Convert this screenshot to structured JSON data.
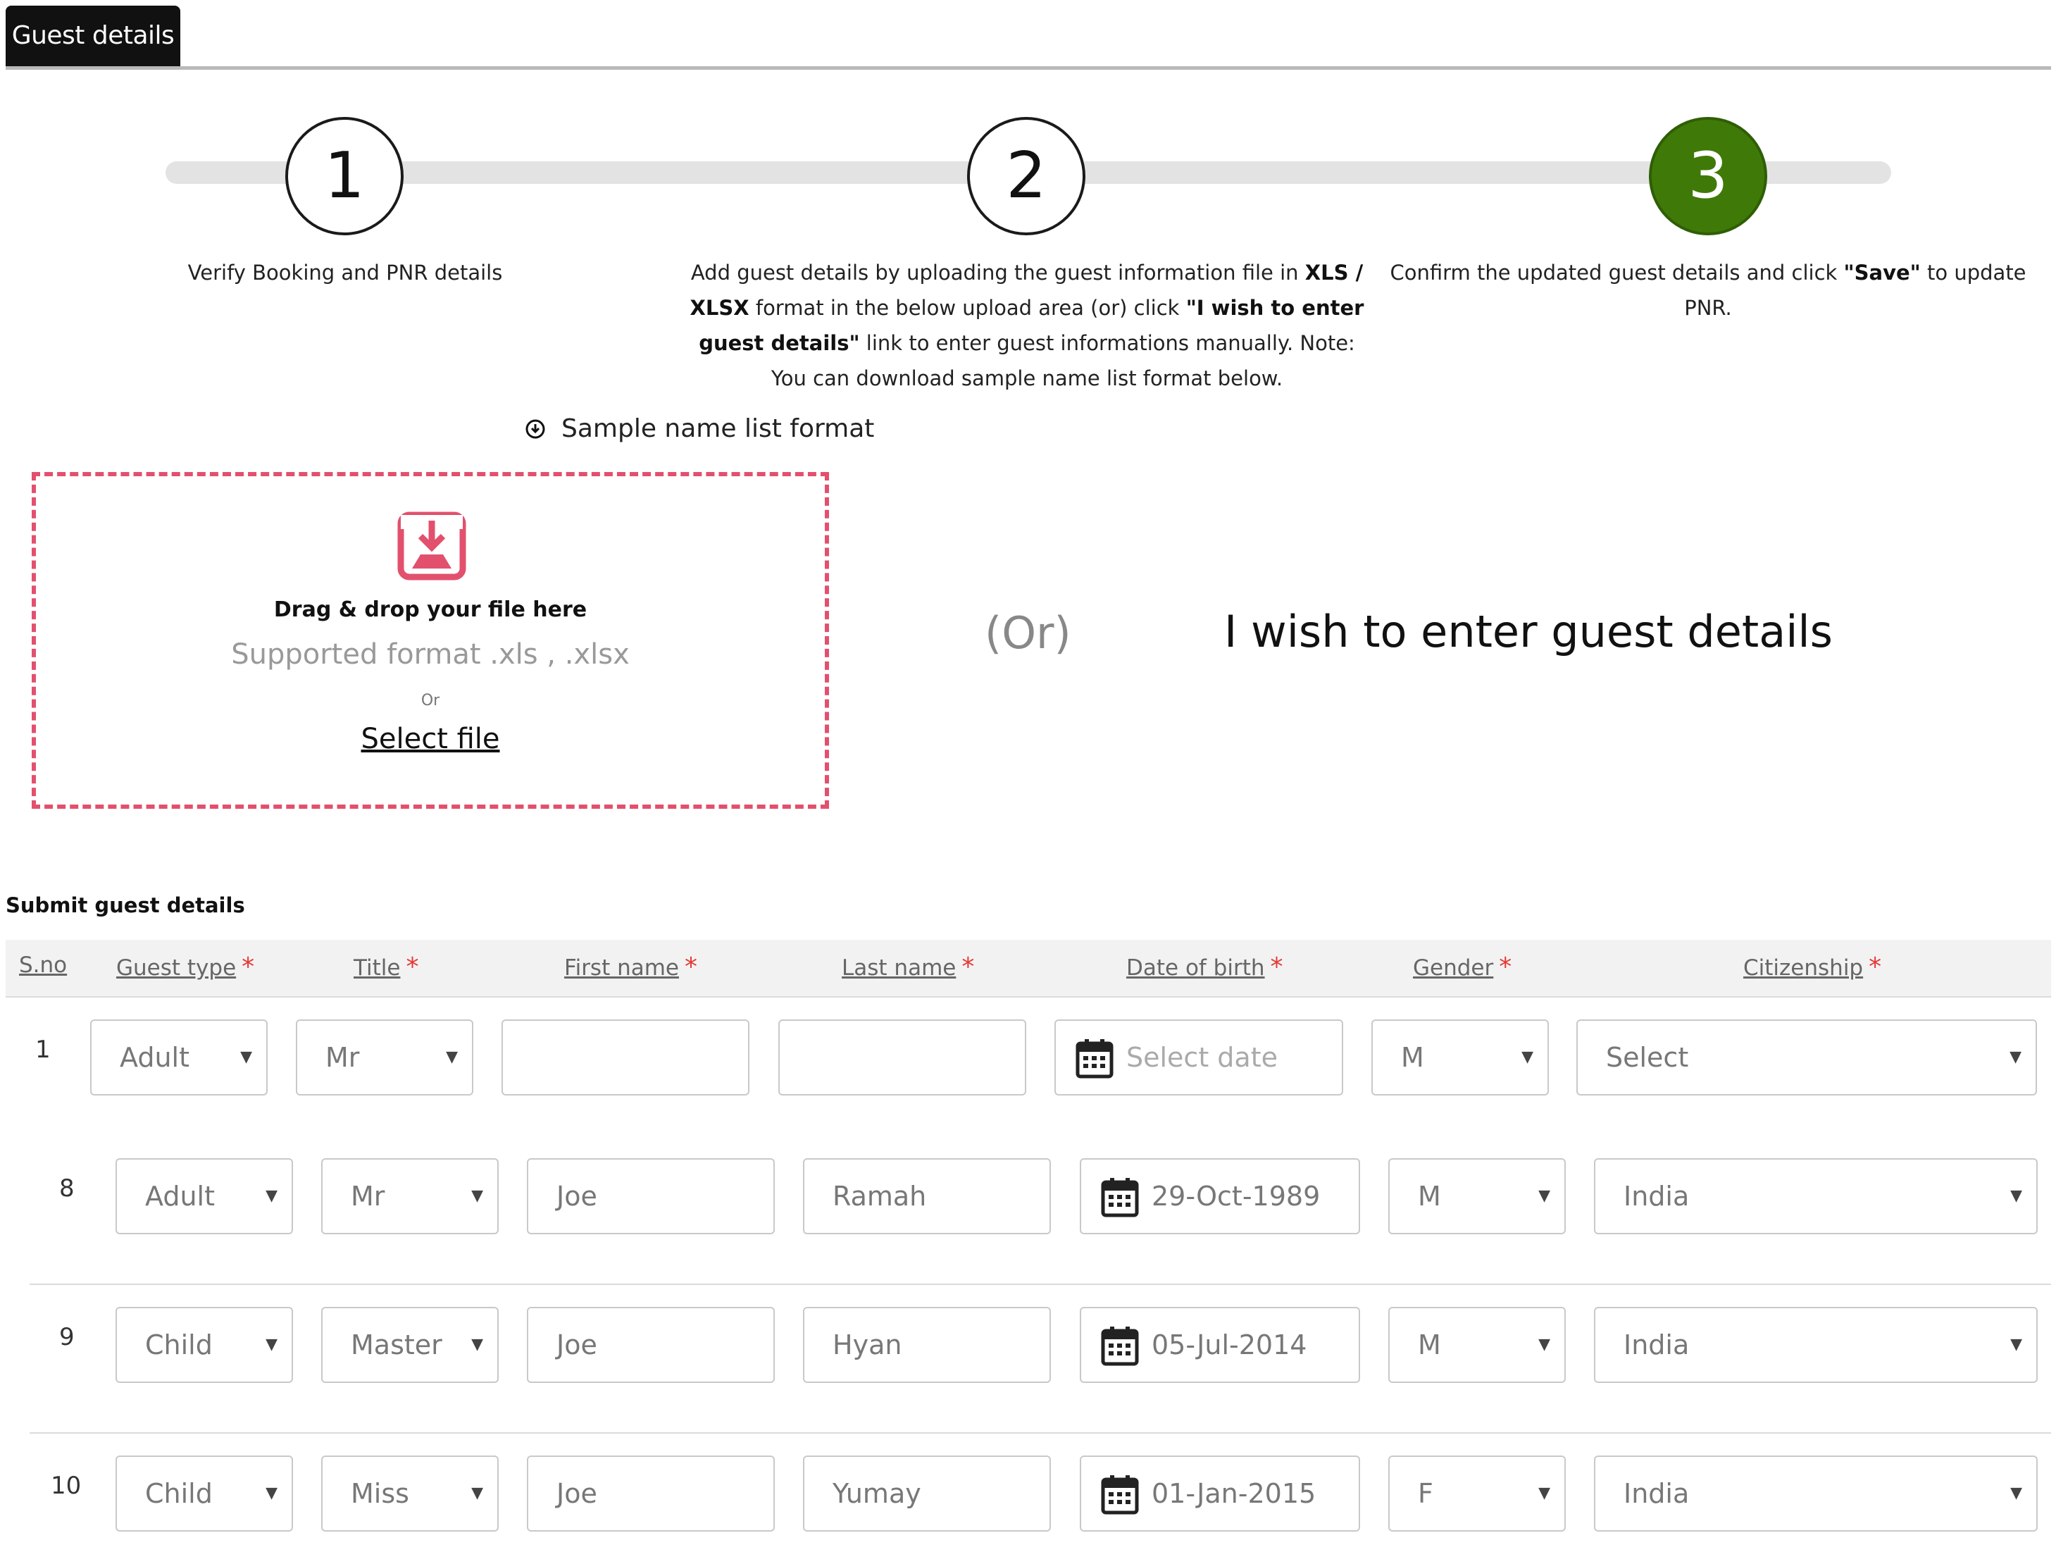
{
  "tabs": {
    "active_label": "Guest details"
  },
  "steps": [
    {
      "number": "1",
      "text_html": "Verify Booking and PNR details"
    },
    {
      "number": "2",
      "text_html": "Add guest details by uploading the guest information file in <b>XLS /<br>XLSX</b> format in the below upload area (or) click <b>\"I wish to enter<br>guest details\"</b> link to enter guest informations manually. Note:<br>You can download sample name list format below."
    },
    {
      "number": "3",
      "text_html": "Confirm the updated guest details and click <b>\"Save\"</b> to update<br>PNR."
    }
  ],
  "upload": {
    "sample_link": "Sample name list format",
    "drop_title": "Drag & drop your file here",
    "supported": "Supported format .xls , .xlsx",
    "or_small": "Or",
    "select_file": "Select file",
    "or_big": "(Or)",
    "manual_link": "I wish to enter guest details"
  },
  "table": {
    "title": "Submit guest details",
    "headers": {
      "sno": "S.no",
      "guest_type": "Guest type",
      "title": "Title",
      "first_name": "First name",
      "last_name": "Last name",
      "dob": "Date of birth",
      "gender": "Gender",
      "citizenship": "Citizenship",
      "required_mark": "*"
    },
    "rows": [
      {
        "sno": "1",
        "guest_type": "Adult",
        "title": "Mr",
        "first_name": "",
        "last_name": "",
        "dob": "",
        "dob_placeholder": "Select date",
        "gender": "M",
        "citizenship": "Select"
      },
      {
        "sno": "8",
        "guest_type": "Adult",
        "title": "Mr",
        "first_name": "Joe",
        "last_name": "Ramah",
        "dob": "29-Oct-1989",
        "gender": "M",
        "citizenship": "India"
      },
      {
        "sno": "9",
        "guest_type": "Child",
        "title": "Master",
        "first_name": "Joe",
        "last_name": "Hyan",
        "dob": "05-Jul-2014",
        "gender": "M",
        "citizenship": "India"
      },
      {
        "sno": "10",
        "guest_type": "Child",
        "title": "Miss",
        "first_name": "Joe",
        "last_name": "Yumay",
        "dob": "01-Jan-2015",
        "gender": "F",
        "citizenship": "India"
      }
    ]
  },
  "colors": {
    "active_step": "#3f7a08",
    "dropzone_border": "#e2506d",
    "required": "#e53935"
  },
  "icons": [
    "download-circle-icon",
    "upload-tray-icon",
    "calendar-icon",
    "caret-down-icon"
  ]
}
